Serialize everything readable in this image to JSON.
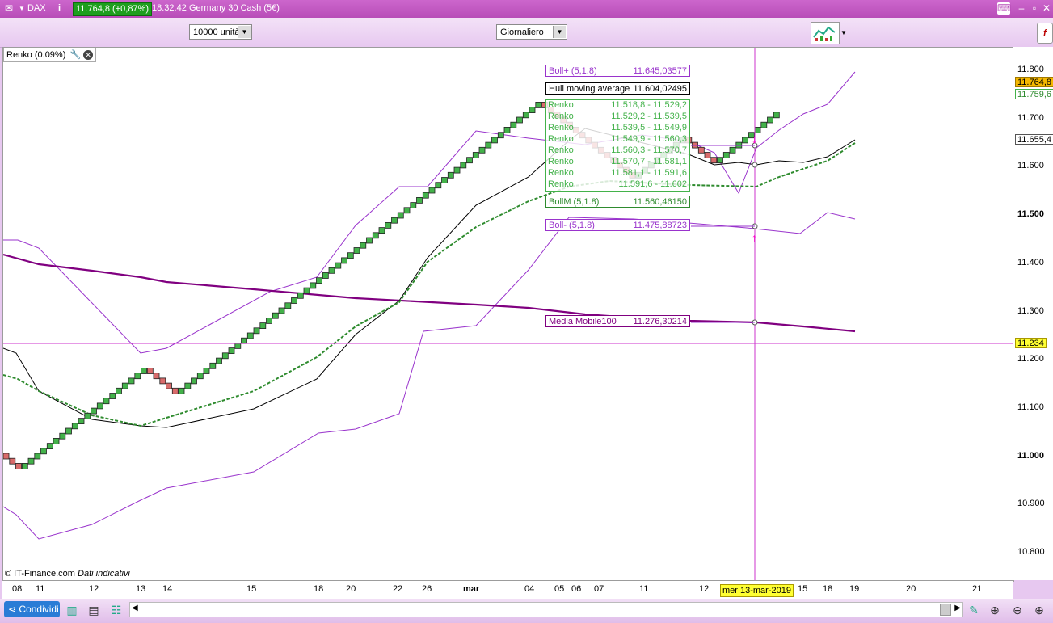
{
  "titlebar": {
    "instrument": "DAX",
    "price_badge": "11.764,8 (+0,87%)",
    "time": "18.32.42",
    "description": "Germany 30 Cash (5€)"
  },
  "toolbar": {
    "units_select": "10000 unità",
    "period_select": "Giornaliero"
  },
  "chart": {
    "indicator_label": "Renko (0.09%)",
    "copyright": "© IT-Finance.com",
    "copyright_note": "Dati indicativi",
    "crosshair_price": "11.234",
    "crosshair_date": "mer 13-mar-2019",
    "last_price": "11.764,8",
    "price_tag_2": "11.759,6",
    "price_tag_3": "11.655,4"
  },
  "y_ticks": [
    "11.800",
    "11.700",
    "11.600",
    "11.500",
    "11.400",
    "11.300",
    "11.200",
    "11.100",
    "11.000",
    "10.900",
    "10.800"
  ],
  "x_ticks": [
    "08",
    "11",
    "12",
    "13",
    "14",
    "15",
    "18",
    "20",
    "22",
    "26",
    "mar",
    "04",
    "05",
    "06",
    "07",
    "11",
    "12",
    "15",
    "18",
    "19",
    "20",
    "21"
  ],
  "tooltips": {
    "boll_plus": {
      "label": "Boll+ (5,1.8)",
      "value": "11.645,03577"
    },
    "hull": {
      "label": "Hull moving average",
      "value": "11.604,02495"
    },
    "renko": [
      {
        "label": "Renko",
        "value": "11.518,8 - 11.529,2"
      },
      {
        "label": "Renko",
        "value": "11.529,2 - 11.539,5"
      },
      {
        "label": "Renko",
        "value": "11.539,5 - 11.549,9"
      },
      {
        "label": "Renko",
        "value": "11.549,9 - 11.560,3"
      },
      {
        "label": "Renko",
        "value": "11.560,3 - 11.570,7"
      },
      {
        "label": "Renko",
        "value": "11.570,7 - 11.581,1"
      },
      {
        "label": "Renko",
        "value": "11.581,1 - 11.591,6"
      },
      {
        "label": "Renko",
        "value": "11.591,6 - 11.602"
      }
    ],
    "boll_mid": {
      "label": "BollM (5,1.8)",
      "value": "11.560,46150"
    },
    "boll_minus": {
      "label": "Boll- (5,1.8)",
      "value": "11.475,88723"
    },
    "ma100": {
      "label": "Media Mobile100",
      "value": "11.276,30214"
    }
  },
  "bottom": {
    "share_label": "Condividi"
  },
  "colors": {
    "up_brick": "#43b24a",
    "down_brick": "#d96b6b",
    "bollinger": "#9933cc",
    "ma100": "#800080",
    "hull": "#000000",
    "boll_mid": "#2e8b2e"
  }
}
